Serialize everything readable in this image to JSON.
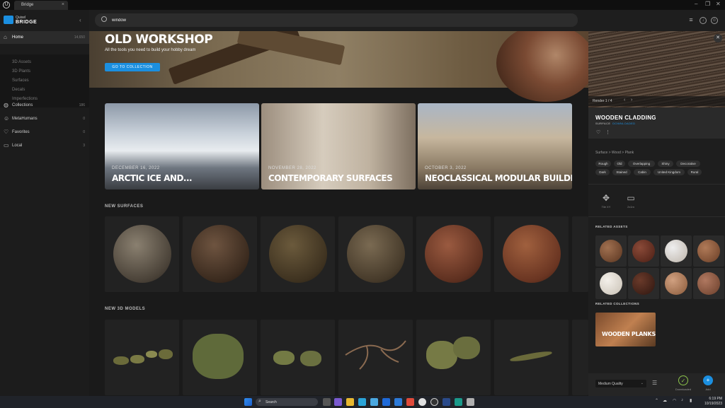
{
  "window": {
    "app_glyph": "U",
    "tab_title": "Bridge",
    "tab_close": "×",
    "minimize": "–",
    "maximize": "❐",
    "close": "✕"
  },
  "sidebar": {
    "logo_line1": "Quixel",
    "logo_line2": "BRIDGE",
    "collapse": "‹",
    "home": {
      "label": "Home",
      "count": "14,650",
      "icon": "home-icon"
    },
    "sub_items": [
      "3D Assets",
      "3D Plants",
      "Surfaces",
      "Decals",
      "Imperfections"
    ],
    "items": [
      {
        "label": "Collections",
        "count": "186",
        "icon": "globe-icon"
      },
      {
        "label": "MetaHumans",
        "count": "0",
        "icon": "person-icon"
      },
      {
        "label": "Favorites",
        "count": "0",
        "icon": "heart-icon"
      },
      {
        "label": "Local",
        "count": "3",
        "icon": "monitor-icon"
      }
    ]
  },
  "search": {
    "value": "window"
  },
  "hero": {
    "title": "OLD WORKSHOP",
    "subtitle": "All the tools you need to build your hobby dream",
    "button": "GO TO COLLECTION"
  },
  "collections": [
    {
      "date": "DECEMBER 16, 2022",
      "title": "ARCTIC ICE AND..."
    },
    {
      "date": "NOVEMBER 28, 2022",
      "title": "CONTEMPORARY SURFACES"
    },
    {
      "date": "OCTOBER 3, 2022",
      "title": "NEOCLASSICAL MODULAR BUILDING..."
    }
  ],
  "sections": {
    "surfaces": "NEW SURFACES",
    "models": "NEW 3D MODELS"
  },
  "colors": {
    "accent": "#1b8fe0",
    "downloaded": "#8bc34a",
    "panel": "#1e1e1e",
    "sidebar": "#1c1c1c"
  },
  "asset": {
    "render_label": "Render 1 / 4",
    "title": "WOODEN CLADDING",
    "type": "SURFACE",
    "status": "DOWNLOADED",
    "breadcrumb": "Surface  >  Wood  >  Plank",
    "tags": [
      "Rough",
      "Old",
      "Overlapping",
      "Shiny",
      "Decorative",
      "Dark",
      "Stained",
      "Cabin",
      "United Kingdom",
      "Rural"
    ],
    "tools": [
      {
        "label": "Tile XY",
        "icon": "move-icon"
      },
      {
        "label": "2x1m",
        "icon": "rectangle-icon"
      }
    ],
    "related_assets_label": "RELATED ASSETS",
    "related_collections_label": "RELATED COLLECTIONS",
    "related_collection": "WOODEN PLANKS",
    "quality": "Medium Quality",
    "downloaded_label": "Downloaded",
    "add_label": "Add"
  },
  "taskbar": {
    "search": "Search",
    "time": "6:19 PM",
    "date": "10/19/2023"
  }
}
